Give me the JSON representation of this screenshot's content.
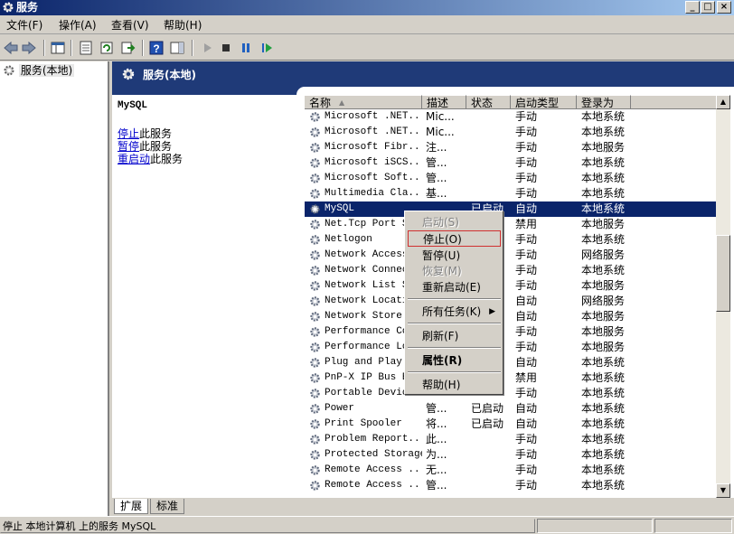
{
  "window": {
    "title": "服务",
    "min_label": "_",
    "max_label": "□",
    "close_label": "×"
  },
  "menubar": [
    {
      "label": "文件(F)"
    },
    {
      "label": "操作(A)"
    },
    {
      "label": "查看(V)"
    },
    {
      "label": "帮助(H)"
    }
  ],
  "toolbar": {
    "icons": [
      "back-icon",
      "forward-icon",
      "show-tree-icon",
      "properties-icon",
      "refresh-icon",
      "export-icon",
      "help-icon",
      "show-action-pane-icon",
      "start-service-icon",
      "stop-service-icon",
      "pause-service-icon",
      "resume-service-icon"
    ]
  },
  "tree": {
    "root_label": "服务(本地)"
  },
  "banner": {
    "title": "服务(本地)"
  },
  "description": {
    "service_name": "MySQL",
    "stop_link": "停止",
    "stop_suffix": "此服务",
    "pause_link": "暂停",
    "pause_suffix": "此服务",
    "restart_link": "重启动",
    "restart_suffix": "此服务"
  },
  "list": {
    "columns": [
      "名称",
      "描述",
      "状态",
      "启动类型",
      "登录为"
    ],
    "sort_indicator": "▲",
    "rows": [
      {
        "name": "Microsoft .NET...",
        "desc": "Mic...",
        "status": "",
        "startup": "手动",
        "logon": "本地系统"
      },
      {
        "name": "Microsoft .NET...",
        "desc": "Mic...",
        "status": "",
        "startup": "手动",
        "logon": "本地系统"
      },
      {
        "name": "Microsoft Fibr...",
        "desc": "注...",
        "status": "",
        "startup": "手动",
        "logon": "本地服务"
      },
      {
        "name": "Microsoft iSCS...",
        "desc": "管...",
        "status": "",
        "startup": "手动",
        "logon": "本地系统"
      },
      {
        "name": "Microsoft Soft...",
        "desc": "管...",
        "status": "",
        "startup": "手动",
        "logon": "本地系统"
      },
      {
        "name": "Multimedia Cla...",
        "desc": "基...",
        "status": "",
        "startup": "手动",
        "logon": "本地系统"
      },
      {
        "name": "MySQL",
        "desc": "",
        "status": "已启动",
        "startup": "自动",
        "logon": "本地系统",
        "selected": true
      },
      {
        "name": "Net.Tcp Port S...",
        "desc": "",
        "status": "",
        "startup": "禁用",
        "logon": "本地服务"
      },
      {
        "name": "Netlogon",
        "desc": "",
        "status": "",
        "startup": "手动",
        "logon": "本地系统"
      },
      {
        "name": "Network Access...",
        "desc": "",
        "status": "",
        "startup": "手动",
        "logon": "网络服务"
      },
      {
        "name": "Network Connec...",
        "desc": "",
        "status": "",
        "startup": "手动",
        "logon": "本地系统"
      },
      {
        "name": "Network List S...",
        "desc": "",
        "status": "",
        "startup": "手动",
        "logon": "本地服务"
      },
      {
        "name": "Network Locati...",
        "desc": "",
        "status": "",
        "startup": "自动",
        "logon": "网络服务"
      },
      {
        "name": "Network Store ...",
        "desc": "",
        "status": "",
        "startup": "自动",
        "logon": "本地服务"
      },
      {
        "name": "Performance Co...",
        "desc": "",
        "status": "",
        "startup": "手动",
        "logon": "本地服务"
      },
      {
        "name": "Performance Lo...",
        "desc": "",
        "status": "",
        "startup": "手动",
        "logon": "本地服务"
      },
      {
        "name": "Plug and Play",
        "desc": "",
        "status": "",
        "startup": "自动",
        "logon": "本地系统"
      },
      {
        "name": "PnP-X IP Bus E...",
        "desc": "",
        "status": "",
        "startup": "禁用",
        "logon": "本地系统"
      },
      {
        "name": "Portable Devic...",
        "desc": "",
        "status": "",
        "startup": "手动",
        "logon": "本地系统"
      },
      {
        "name": "Power",
        "desc": "管...",
        "status": "已启动",
        "startup": "自动",
        "logon": "本地系统"
      },
      {
        "name": "Print Spooler",
        "desc": "将...",
        "status": "已启动",
        "startup": "自动",
        "logon": "本地系统"
      },
      {
        "name": "Problem Report...",
        "desc": "此...",
        "status": "",
        "startup": "手动",
        "logon": "本地系统"
      },
      {
        "name": "Protected Storage",
        "desc": "为...",
        "status": "",
        "startup": "手动",
        "logon": "本地系统"
      },
      {
        "name": "Remote Access ...",
        "desc": "无...",
        "status": "",
        "startup": "手动",
        "logon": "本地系统"
      },
      {
        "name": "Remote Access ...",
        "desc": "管...",
        "status": "",
        "startup": "手动",
        "logon": "本地系统"
      },
      {
        "name": "",
        "desc": "",
        "status": "",
        "startup": "",
        "logon": ""
      }
    ]
  },
  "context_menu": {
    "items": [
      {
        "label": "启动(S)",
        "disabled": true
      },
      {
        "label": "停止(O)",
        "highlighted": true
      },
      {
        "label": "暂停(U)"
      },
      {
        "label": "恢复(M)",
        "disabled": true
      },
      {
        "label": "重新启动(E)"
      },
      {
        "label": "所有任务(K)",
        "submenu": true,
        "arrow": "▶"
      },
      {
        "label": "刷新(F)"
      },
      {
        "label": "属性(R)",
        "bold": true
      },
      {
        "label": "帮助(H)"
      }
    ]
  },
  "tabs": [
    {
      "label": "扩展",
      "active": true
    },
    {
      "label": "标准",
      "active": false
    }
  ],
  "statusbar": {
    "text": "停止 本地计算机 上的服务 MySQL"
  },
  "colors": {
    "selection": "#0a246a",
    "banner": "#1f3a78",
    "highlight_border": "#d03030",
    "link": "#0000cc"
  }
}
